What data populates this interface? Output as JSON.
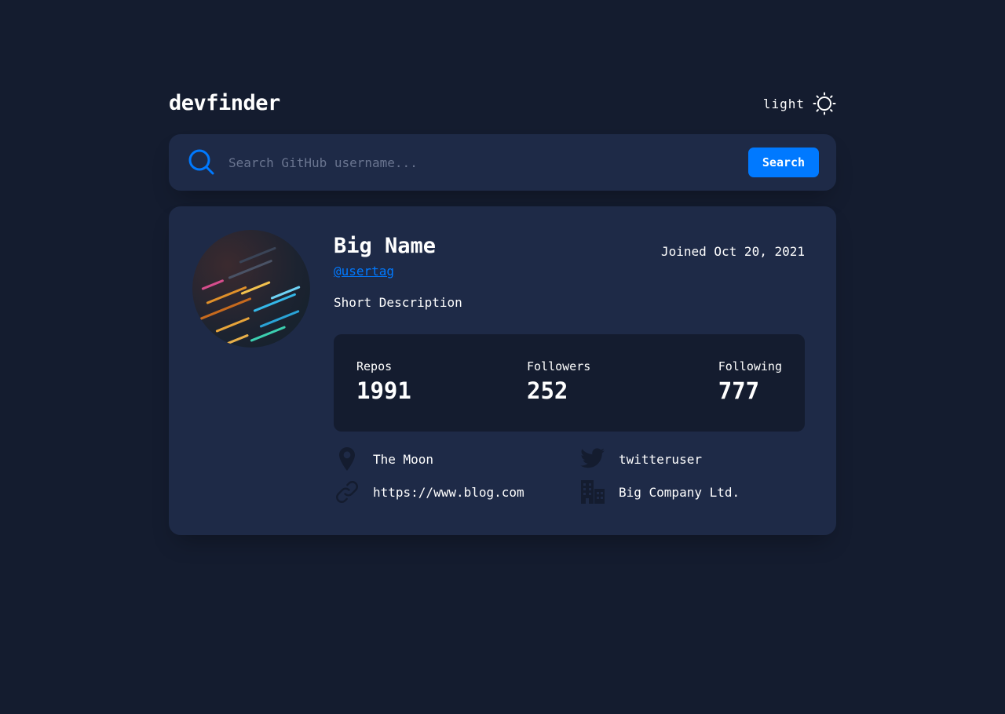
{
  "app": {
    "logo": "devfinder",
    "theme_label": "light"
  },
  "search": {
    "placeholder": "Search GitHub username...",
    "value": "",
    "button_label": "Search"
  },
  "profile": {
    "name": "Big Name",
    "login": "@usertag",
    "joined": "Joined Oct 20, 2021",
    "bio": "Short Description",
    "stats": {
      "repos_label": "Repos",
      "repos_value": "1991",
      "followers_label": "Followers",
      "followers_value": "252",
      "following_label": "Following",
      "following_value": "777"
    },
    "links": {
      "location": "The Moon",
      "blog": "https://www.blog.com",
      "twitter": "twitteruser",
      "company": "Big Company Ltd."
    }
  },
  "colors": {
    "background": "#141c2f",
    "card": "#1e2a47",
    "accent": "#0079ff",
    "text": "#ffffff",
    "icon_muted": "#141c2f"
  },
  "icons": {
    "theme": "sun-icon",
    "search": "search-icon",
    "location": "map-pin-icon",
    "blog": "link-icon",
    "twitter": "twitter-icon",
    "company": "building-icon"
  }
}
